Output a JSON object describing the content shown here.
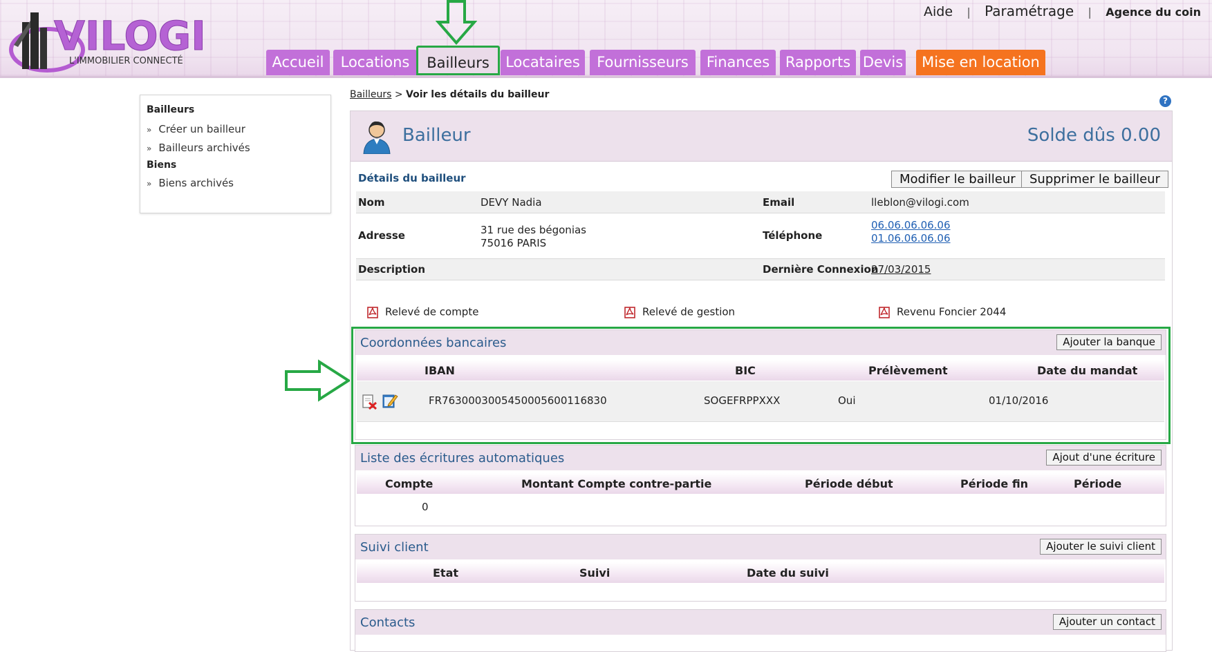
{
  "header": {
    "logo_text": "VILOGI",
    "logo_tagline": "L'IMMOBILIER CONNECTÉ",
    "top_links": [
      "Aide",
      "Paramétrage",
      "Agence du coin"
    ],
    "nav_tabs": [
      {
        "label": "Accueil"
      },
      {
        "label": "Locations"
      },
      {
        "label": "Bailleurs"
      },
      {
        "label": "Locataires"
      },
      {
        "label": "Fournisseurs"
      },
      {
        "label": "Finances"
      },
      {
        "label": "Rapports"
      },
      {
        "label": "Devis"
      },
      {
        "label": "Mise en location"
      }
    ],
    "active_tab": "Bailleurs",
    "colors": {
      "tab": "#c270d9",
      "tab_highlight": "#f5731f",
      "annotation": "#27a845"
    }
  },
  "sidebar": {
    "section1_title": "Bailleurs",
    "section1_items": [
      "Créer un bailleur",
      "Bailleurs archivés"
    ],
    "section2_title": "Biens",
    "section2_items": [
      "Biens archivés"
    ]
  },
  "breadcrumb": {
    "link": "Bailleurs",
    "separator": ">",
    "current": "Voir les détails du bailleur"
  },
  "panel": {
    "title": "Bailleur",
    "solde": "Solde dûs 0.00",
    "details_label": "Détails du bailleur",
    "modify_button": "Modifier le bailleur",
    "delete_button": "Supprimer le bailleur",
    "fields": {
      "nom_label": "Nom",
      "nom_value": "DEVY Nadia",
      "email_label": "Email",
      "email_value": "lleblon@vilogi.com",
      "adresse_label": "Adresse",
      "adresse_line1": "31 rue des bégonias",
      "adresse_line2": "75016 PARIS",
      "telephone_label": "Téléphone",
      "telephone1": "06.06.06.06.06",
      "telephone2": "01.06.06.06.06",
      "description_label": "Description",
      "derniere_connexion_label": "Dernière Connexion",
      "derniere_connexion_value": "27/03/2015"
    },
    "documents": [
      "Relevé de compte",
      "Relevé de gestion",
      "Revenu Foncier 2044"
    ]
  },
  "bank": {
    "title": "Coordonnées bancaires",
    "add_button": "Ajouter la banque",
    "columns": [
      "IBAN",
      "BIC",
      "Prélèvement",
      "Date du mandat"
    ],
    "rows": [
      {
        "iban": "FR7630003005450005600116830",
        "bic": "SOGEFRPPXXX",
        "prelevement": "Oui",
        "date_mandat": "01/10/2016"
      }
    ]
  },
  "ecritures": {
    "title": "Liste des écritures automatiques",
    "add_button": "Ajout d'une écriture",
    "columns": [
      "Compte",
      "Montant Compte contre-partie",
      "Période début",
      "Période fin",
      "Période"
    ],
    "rows": [
      {
        "compte": "0"
      }
    ]
  },
  "suivi": {
    "title": "Suivi client",
    "add_button": "Ajouter le suivi client",
    "columns": [
      "Etat",
      "Suivi",
      "Date du suivi"
    ]
  },
  "contacts": {
    "title": "Contacts",
    "add_button": "Ajouter un contact"
  }
}
